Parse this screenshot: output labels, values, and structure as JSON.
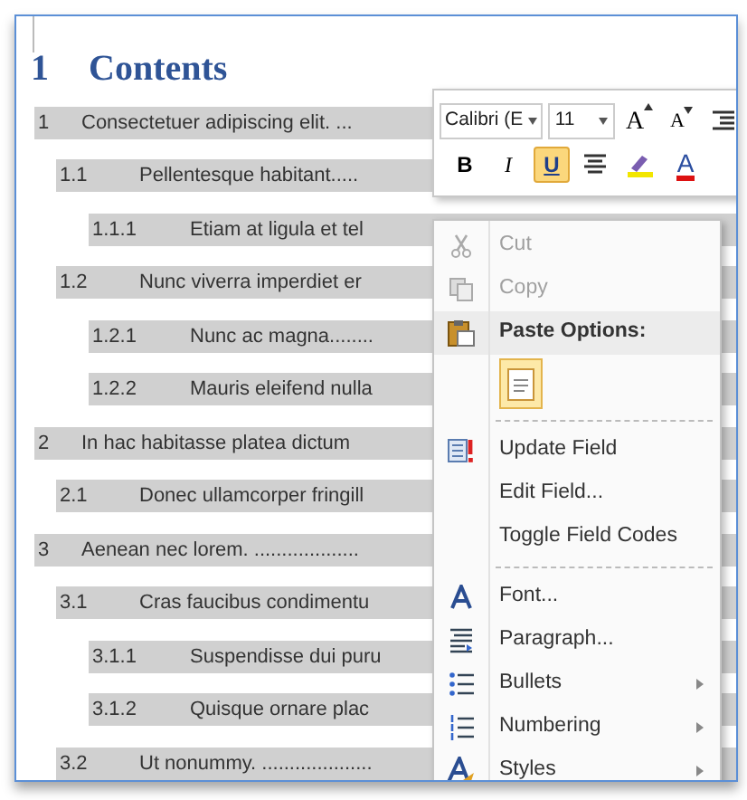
{
  "heading": {
    "number": "1",
    "title": "Contents"
  },
  "toc": [
    {
      "number": "1",
      "title": "Consectetuer adipiscing elit. ...",
      "children": [
        {
          "number": "1.1",
          "title": "Pellentesque habitant.....",
          "children": [
            {
              "number": "1.1.1",
              "title": "Etiam at ligula et tel"
            }
          ]
        },
        {
          "number": "1.2",
          "title": "Nunc viverra imperdiet er",
          "children": [
            {
              "number": "1.2.1",
              "title": "Nunc ac magna........"
            },
            {
              "number": "1.2.2",
              "title": "Mauris eleifend nulla"
            }
          ]
        }
      ]
    },
    {
      "number": "2",
      "title": "In hac habitasse platea dictum",
      "children": [
        {
          "number": "2.1",
          "title": "Donec ullamcorper fringill"
        }
      ]
    },
    {
      "number": "3",
      "title": "Aenean nec lorem. ...................",
      "children": [
        {
          "number": "3.1",
          "title": "Cras faucibus condimentu",
          "children": [
            {
              "number": "3.1.1",
              "title": "Suspendisse dui puru"
            },
            {
              "number": "3.1.2",
              "title": "Quisque ornare plac"
            }
          ]
        },
        {
          "number": "3.2",
          "title": "Ut nonummy. ...................."
        }
      ]
    }
  ],
  "mini_toolbar": {
    "font": "Calibri (E",
    "size": "11",
    "row1": [
      {
        "kind": "grow",
        "label": "A",
        "selected": false
      },
      {
        "kind": "shrink",
        "label": "A",
        "selected": false
      },
      {
        "kind": "indent",
        "selected": false
      }
    ],
    "row2": [
      {
        "kind": "bold",
        "label": "B",
        "selected": false
      },
      {
        "kind": "italic",
        "label": "I",
        "selected": false
      },
      {
        "kind": "underline",
        "label": "U",
        "selected": true
      },
      {
        "kind": "align",
        "selected": false
      },
      {
        "kind": "highlight",
        "selected": false
      },
      {
        "kind": "fontcolor",
        "label": "A",
        "selected": false
      }
    ]
  },
  "context_menu": [
    {
      "kind": "cut",
      "label": "Cut",
      "disabled": true,
      "submenu": false
    },
    {
      "kind": "copy",
      "label": "Copy",
      "disabled": true,
      "submenu": false
    },
    {
      "kind": "header",
      "label": "Paste Options:"
    },
    {
      "kind": "paste"
    },
    {
      "kind": "separator"
    },
    {
      "kind": "update",
      "label": "Update Field",
      "disabled": false,
      "submenu": false
    },
    {
      "kind": "plain",
      "label": "Edit Field...",
      "disabled": false,
      "submenu": false
    },
    {
      "kind": "plain",
      "label": "Toggle Field Codes",
      "disabled": false,
      "submenu": false
    },
    {
      "kind": "separator"
    },
    {
      "kind": "font",
      "label": "Font...",
      "disabled": false,
      "submenu": false
    },
    {
      "kind": "paragraph",
      "label": "Paragraph...",
      "disabled": false,
      "submenu": false
    },
    {
      "kind": "bullets",
      "label": "Bullets",
      "disabled": false,
      "submenu": true
    },
    {
      "kind": "numbering",
      "label": "Numbering",
      "disabled": false,
      "submenu": true
    },
    {
      "kind": "styles",
      "label": "Styles",
      "disabled": false,
      "submenu": true
    }
  ]
}
